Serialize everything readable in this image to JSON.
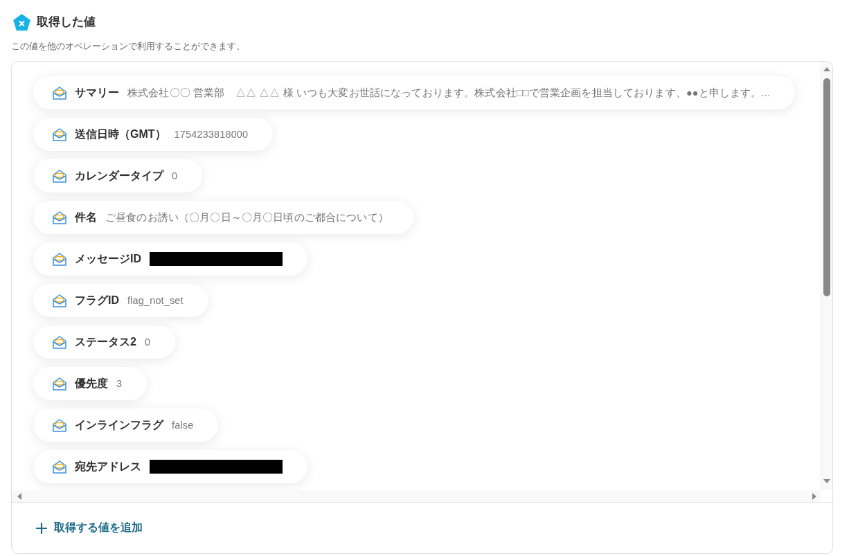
{
  "header": {
    "title": "取得した値",
    "description": "この値を他のオペレーションで利用することができます。"
  },
  "values": [
    {
      "label": "サマリー",
      "value": "株式会社〇〇 営業部　△△ △△ 様 いつも大変お世話になっております。株式会社□□で営業企画を担当しております、●●と申します。...",
      "redacted": false
    },
    {
      "label": "送信日時（GMT）",
      "value": "1754233818000",
      "redacted": false
    },
    {
      "label": "カレンダータイプ",
      "value": "0",
      "redacted": false
    },
    {
      "label": "件名",
      "value": "ご昼食のお誘い（〇月〇日～〇月〇日頃のご都合について）",
      "redacted": false
    },
    {
      "label": "メッセージID",
      "redacted": true
    },
    {
      "label": "フラグID",
      "value": "flag_not_set",
      "redacted": false
    },
    {
      "label": "ステータス2",
      "value": "0",
      "redacted": false
    },
    {
      "label": "優先度",
      "value": "3",
      "redacted": false
    },
    {
      "label": "インラインフラグ",
      "value": "false",
      "redacted": false
    },
    {
      "label": "宛先アドレス",
      "redacted": true
    }
  ],
  "add_button": {
    "label": "取得する値を追加"
  }
}
